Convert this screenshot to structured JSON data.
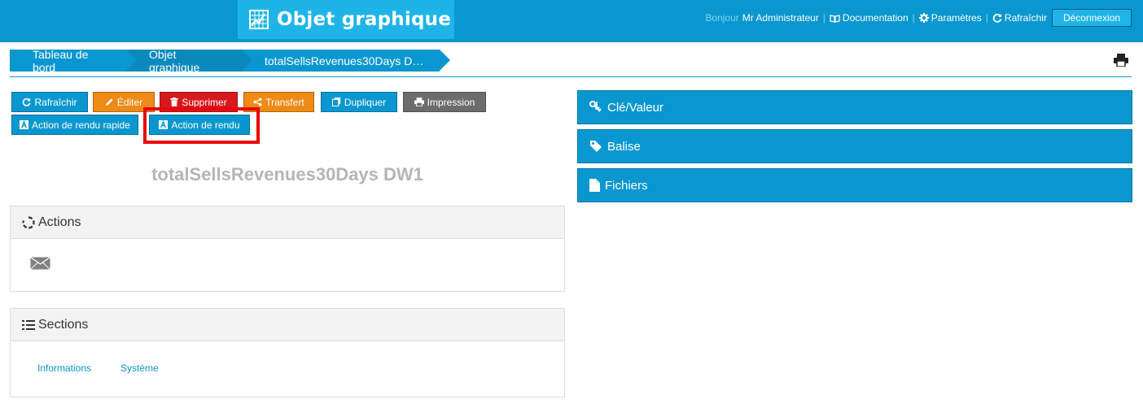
{
  "header": {
    "app_title": "Objet graphique",
    "greeting": "Bonjour",
    "user": "Mr Administrateur",
    "documentation": "Documentation",
    "settings": "Paramètres",
    "refresh": "Rafraîchir",
    "logout": "Déconnexion",
    "sep": "|"
  },
  "breadcrumb": {
    "items": [
      "Tableau de bord",
      "Objet graphique",
      "totalSellsRevenues30Days D…"
    ]
  },
  "toolbar": {
    "refresh": "Rafraîchir",
    "edit": "Éditer",
    "delete": "Supprimer",
    "transfer": "Transfert",
    "duplicate": "Dupliquer",
    "print": "Impression",
    "quick_render": "Action de rendu rapide",
    "render": "Action de rendu"
  },
  "object": {
    "title": "totalSellsRevenues30Days DW1"
  },
  "actions_panel": {
    "title": "Actions",
    "icon": "envelope-icon"
  },
  "sections_panel": {
    "title": "Sections",
    "links": [
      "Informations",
      "Système"
    ]
  },
  "accordion": {
    "items": [
      "Clé/Valeur",
      "Balise",
      "Fichiers"
    ]
  },
  "colors": {
    "primary": "#0a97cf",
    "title_bg": "#1fb4e8",
    "edit": "#ee8a16",
    "delete": "#d6191d",
    "print": "#6c6c6c",
    "highlight": "#e8060a"
  }
}
